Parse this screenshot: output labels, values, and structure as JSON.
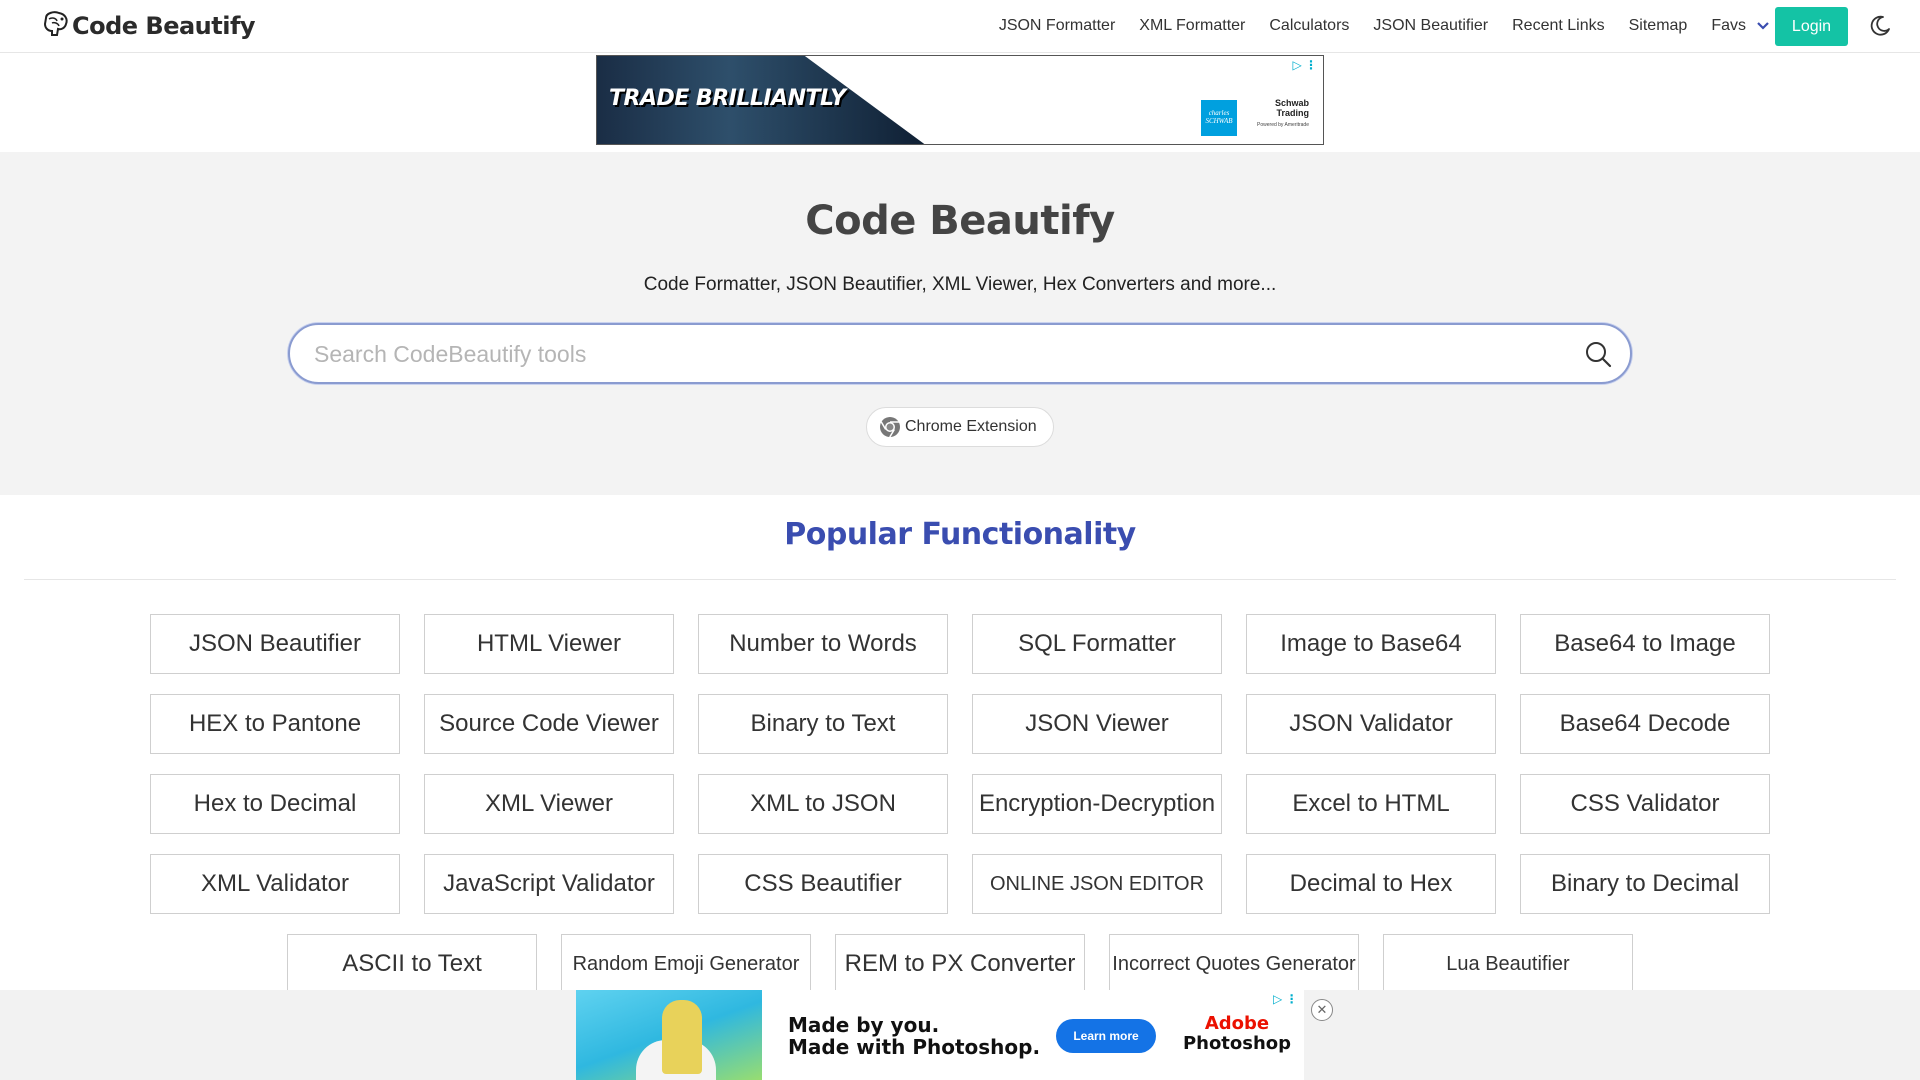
{
  "header": {
    "logo_text": "Code Beautify",
    "nav": [
      "JSON Formatter",
      "XML Formatter",
      "Calculators",
      "JSON Beautifier",
      "Recent Links",
      "Sitemap"
    ],
    "favs_label": "Favs",
    "login_label": "Login"
  },
  "ad_top": {
    "headline": "TRADE BRILLIANTLY",
    "brand_box": "charles SCHWAB",
    "brand_name": "Schwab",
    "brand_sub": "Trading",
    "brand_powered": "Powered by Ameritrade"
  },
  "hero": {
    "title": "Code Beautify",
    "subtitle": "Code Formatter, JSON Beautifier, XML Viewer, Hex Converters and more...",
    "search_placeholder": "Search CodeBeautify tools",
    "chrome_extension_label": "Chrome Extension"
  },
  "popular": {
    "title": "Popular Functionality",
    "rows": [
      [
        "JSON Beautifier",
        "HTML Viewer",
        "Number to Words",
        "SQL Formatter",
        "Image to Base64",
        "Base64 to Image"
      ],
      [
        "HEX to Pantone",
        "Source Code Viewer",
        "Binary to Text",
        "JSON Viewer",
        "JSON Validator",
        "Base64 Decode"
      ],
      [
        "Hex to Decimal",
        "XML Viewer",
        "XML to JSON",
        "Encryption-Decryption",
        "Excel to HTML",
        "CSS Validator"
      ],
      [
        "XML Validator",
        "JavaScript Validator",
        "CSS Beautifier",
        "ONLINE JSON EDITOR",
        "Decimal to Hex",
        "Binary to Decimal"
      ],
      [
        "ASCII to Text",
        "Random Emoji Generator",
        "REM to PX Converter",
        "Incorrect Quotes Generator",
        "Lua Beautifier"
      ]
    ]
  },
  "ad_bottom": {
    "line1": "Made by you.",
    "line2": "Made with Photoshop.",
    "cta": "Learn more",
    "brand1": "Adobe",
    "brand2": "Photoshop",
    "close": "✕"
  },
  "colors": {
    "accent": "#14c3a5",
    "popular_title": "#3a4db0",
    "hero_bg": "#f3f3f3"
  }
}
